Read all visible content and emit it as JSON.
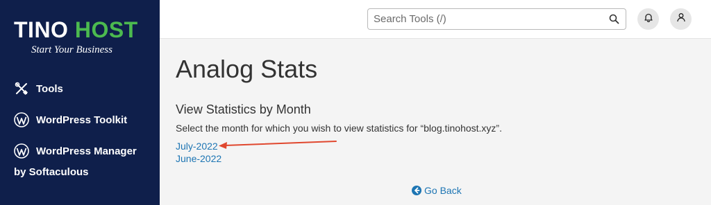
{
  "sidebar": {
    "logo": {
      "part1": "TINO",
      "part2": "HOST",
      "tagline": "Start Your Business"
    },
    "items": [
      {
        "label": "Tools",
        "icon": "tools-icon"
      },
      {
        "label": "WordPress Toolkit",
        "icon": "wordpress-icon"
      },
      {
        "label": "WordPress Manager",
        "icon": "wordpress-icon",
        "sub": "by Softaculous"
      }
    ]
  },
  "header": {
    "search": {
      "placeholder": "Search Tools (/)",
      "icon": "search-icon"
    },
    "notifications_icon": "bell-icon",
    "user_icon": "user-icon"
  },
  "main": {
    "title": "Analog Stats",
    "section_title": "View Statistics by Month",
    "description": "Select the month for which you wish to view statistics for “blog.tinohost.xyz”.",
    "months": [
      "July-2022",
      "June-2022"
    ],
    "go_back": "Go Back"
  },
  "colors": {
    "sidebar_bg": "#0f1f4b",
    "brand_green": "#4cba4f",
    "link": "#1d75b3",
    "annotation_arrow": "#e0472e"
  }
}
